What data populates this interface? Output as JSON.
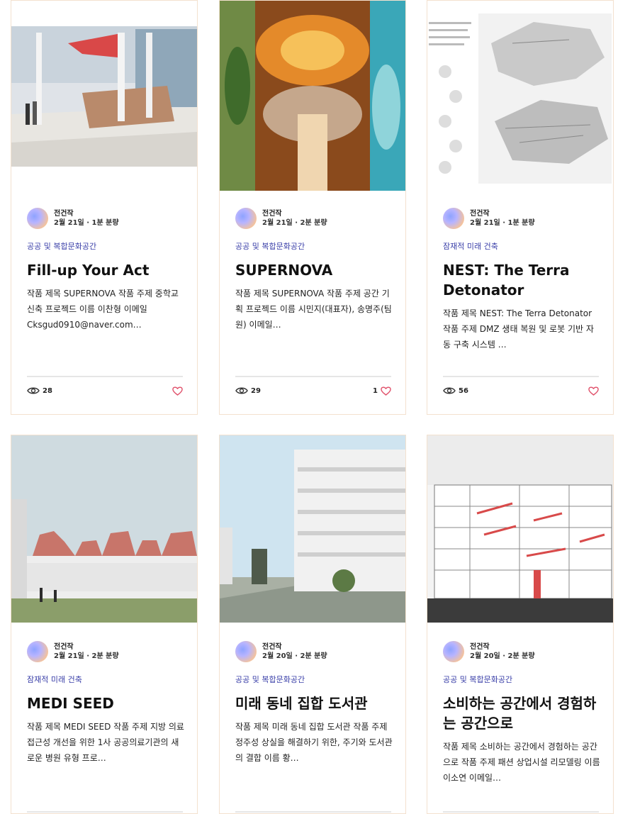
{
  "cards": [
    {
      "author": "전건작",
      "date": "2월 21일",
      "read_time": "1분 분량",
      "category": "공공 및 복합문화공간",
      "title": "Fill-up Your Act",
      "description": "작품 제목 SUPERNOVA 작품 주제 중학교 신축 프로젝드 이름 이찬형 이메일 Cksgud0910@naver.com…",
      "views": "28",
      "likes": ""
    },
    {
      "author": "전건작",
      "date": "2월 21일",
      "read_time": "2분 분량",
      "category": "공공 및 복합문화공간",
      "title": "SUPERNOVA",
      "description": "작품 제목 SUPERNOVA 작품 주제 공간 기획 프로젝드 이름 시민지(대표자), 송명주(팀원) 이메일…",
      "views": "29",
      "likes": "1"
    },
    {
      "author": "전건작",
      "date": "2월 21일",
      "read_time": "1분 분량",
      "category": "잠재적 미래 건축",
      "title": "NEST: The Terra Detonator",
      "description": "작품 제목 NEST: The Terra Detonator 작품 주제 DMZ 생태 복원 및 로봇 기반 자동 구축 시스템 …",
      "views": "56",
      "likes": ""
    },
    {
      "author": "전건작",
      "date": "2월 21일",
      "read_time": "2분 분량",
      "category": "잠재적 미래 건축",
      "title": "MEDI SEED",
      "description": "작품 제목 MEDI SEED 작품 주제 지방 의료 접근성 개선을 위한 1사 공공의료기관의 새로운 병원 유형 프로…",
      "views": "",
      "likes": ""
    },
    {
      "author": "전건작",
      "date": "2월 20일",
      "read_time": "2분 분량",
      "category": "공공 및 복합문화공간",
      "title": "미래 동네 집합 도서관",
      "description": "작품 제목 미래 동네 집합 도서관 작품 주제 정주성 상실을 해결하기 위한, 주기와 도서관의 결합 이름 황…",
      "views": "",
      "likes": ""
    },
    {
      "author": "전건작",
      "date": "2월 20일",
      "read_time": "2분 분량",
      "category": "공공 및 복합문화공간",
      "title": "소비하는 공간에서 경험하는 공간으로",
      "description": "작품 제목 소비하는 공간에서 경험하는 공간으로 작품 주제 패션 상업시설 리모델링 이름 이소연 이메일…",
      "views": "",
      "likes": ""
    }
  ],
  "icons": {
    "views": "eye-icon",
    "likes": "heart-icon"
  },
  "colors": {
    "category": "#3a3fa8",
    "heart": "#e0506a",
    "card_border": "#f3e1cf"
  }
}
